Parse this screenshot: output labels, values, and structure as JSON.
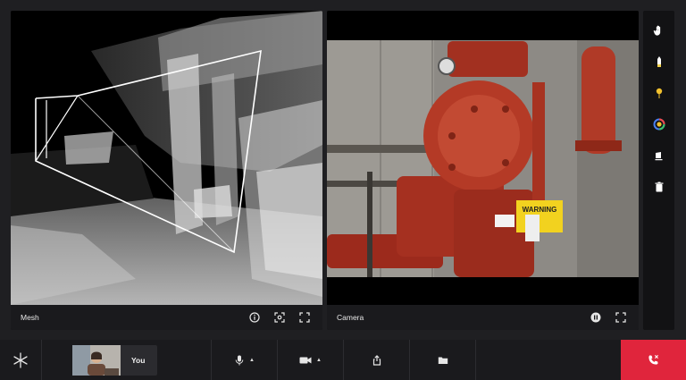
{
  "mesh_panel": {
    "label": "Mesh",
    "controls": [
      "info-icon",
      "focus-icon",
      "fullscreen-icon"
    ]
  },
  "camera_panel": {
    "label": "Camera",
    "controls": [
      "pause-icon",
      "fullscreen-icon"
    ],
    "warning_sign_text": "WARNING"
  },
  "toolbar": {
    "tools": [
      {
        "name": "hand-tool",
        "icon": "hand-icon",
        "color": "#ffffff"
      },
      {
        "name": "highlighter-tool",
        "icon": "highlighter-icon",
        "color": "#f2d14a"
      },
      {
        "name": "pin-tool",
        "icon": "pin-icon",
        "color": "#f2c12e"
      },
      {
        "name": "color-tool",
        "icon": "color-wheel-icon",
        "color": "#f2c12e"
      },
      {
        "name": "eraser-tool",
        "icon": "eraser-icon",
        "color": "#ffffff"
      },
      {
        "name": "delete-tool",
        "icon": "trash-icon",
        "color": "#ffffff"
      }
    ]
  },
  "bottom_bar": {
    "self_name": "You",
    "mic_caret": "▲",
    "video_caret": "▲",
    "end_call_color": "#e0253c"
  }
}
